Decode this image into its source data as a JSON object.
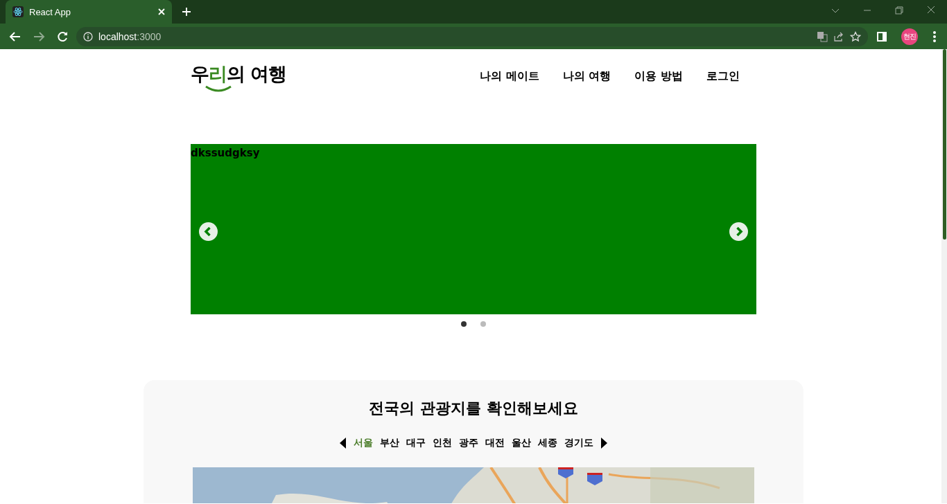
{
  "browser": {
    "tab_title": "React App",
    "url_host": "localhost",
    "url_port": ":3000",
    "profile": "현진"
  },
  "header": {
    "logo_parts": [
      "우",
      "리",
      "의 여행"
    ],
    "nav": [
      "나의 메이트",
      "나의 여행",
      "이용 방법",
      "로그인"
    ]
  },
  "carousel": {
    "slide_text": "dkssudgksy",
    "dots": [
      {
        "selected": true
      },
      {
        "selected": false
      }
    ]
  },
  "section": {
    "title": "전국의 관광지를 확인해보세요",
    "regions": [
      {
        "label": "서울",
        "selected": true
      },
      {
        "label": "부산",
        "selected": false
      },
      {
        "label": "대구",
        "selected": false
      },
      {
        "label": "인천",
        "selected": false
      },
      {
        "label": "광주",
        "selected": false
      },
      {
        "label": "대전",
        "selected": false
      },
      {
        "label": "울산",
        "selected": false
      },
      {
        "label": "세종",
        "selected": false
      },
      {
        "label": "경기도",
        "selected": false
      }
    ]
  }
}
